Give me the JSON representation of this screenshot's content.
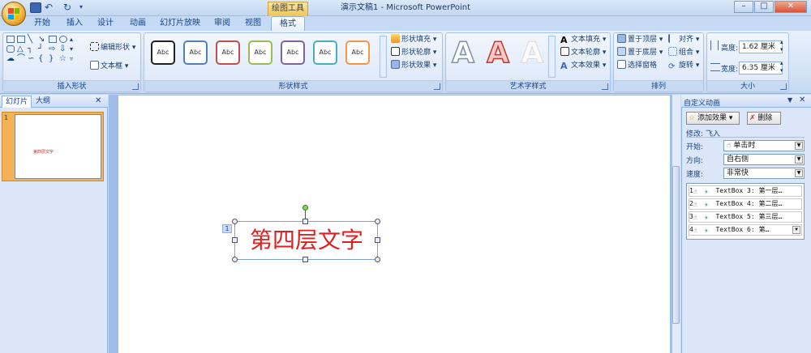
{
  "window": {
    "title": "演示文稿1 - Microsoft PowerPoint",
    "context_tab": "绘图工具",
    "minimize": "–",
    "maximize": "□",
    "close": "✕"
  },
  "tabs": [
    "开始",
    "插入",
    "设计",
    "动画",
    "幻灯片放映",
    "审阅",
    "视图",
    "格式"
  ],
  "active_tab": "格式",
  "ribbon": {
    "insert_shapes": {
      "label": "插入形状",
      "edit_shape": "编辑形状",
      "text_box": "文本框"
    },
    "shape_styles": {
      "label": "形状样式",
      "gallery": [
        "Abc",
        "Abc",
        "Abc",
        "Abc",
        "Abc",
        "Abc",
        "Abc"
      ],
      "gallery_colors": [
        "#222222",
        "#4f81bd",
        "#c0504d",
        "#9bbb59",
        "#8064a2",
        "#4bacc6",
        "#f79646"
      ],
      "fill": "形状填充",
      "outline": "形状轮廓",
      "effects": "形状效果"
    },
    "wordart": {
      "label": "艺术字样式",
      "gallery": [
        "A",
        "A",
        "A"
      ],
      "fill": "文本填充",
      "outline": "文本轮廓",
      "effects": "文本效果"
    },
    "arrange": {
      "label": "排列",
      "bring_front": "置于顶层",
      "send_back": "置于底层",
      "selection_pane": "选择窗格",
      "align": "对齐",
      "group": "组合",
      "rotate": "旋转"
    },
    "size": {
      "label": "大小",
      "height_label": "高度:",
      "height_value": "1.62 厘米",
      "width_label": "宽度:",
      "width_value": "6.35 厘米"
    }
  },
  "slides_pane": {
    "tab_slides": "幻灯片",
    "tab_outline": "大纲",
    "close": "✕",
    "slide_number": "1",
    "thumb_text": "第四层文字"
  },
  "slide": {
    "textbox_text": "第四层文字",
    "anim_badge": "1"
  },
  "anim_pane": {
    "title": "自定义动画",
    "add_effect": "添加效果",
    "remove": "删除",
    "modify": "修改: 飞入",
    "start_label": "开始:",
    "start_value": "单击时",
    "direction_label": "方向:",
    "direction_value": "自右侧",
    "speed_label": "速度:",
    "speed_value": "非常快",
    "items": [
      {
        "num": "1",
        "text": "TextBox 3: 第一层…"
      },
      {
        "num": "2",
        "text": "TextBox 4: 第二层…"
      },
      {
        "num": "3",
        "text": "TextBox 5: 第三层…"
      },
      {
        "num": "4",
        "text": "TextBox 6: 第…"
      }
    ]
  },
  "colors": {
    "accent": "#15428b",
    "slide_text": "#e02020",
    "selected_thumb": "#f4b256"
  }
}
